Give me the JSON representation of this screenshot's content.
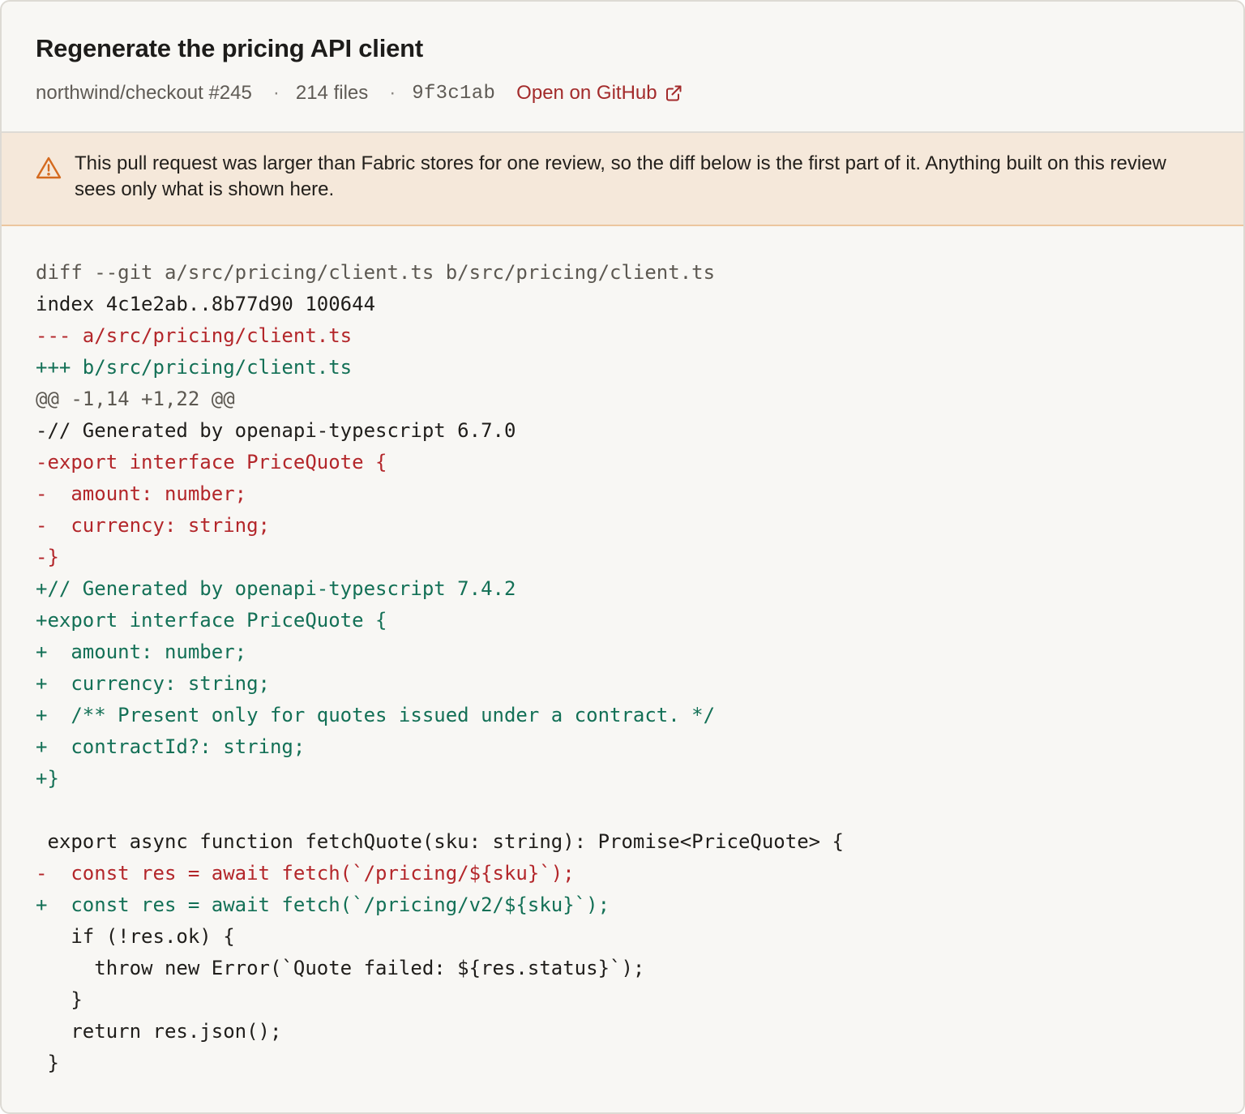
{
  "header": {
    "title": "Regenerate the pricing API client",
    "repo_pr": "northwind/checkout #245",
    "separator": "·",
    "files": "214 files",
    "commit": "9f3c1ab",
    "github_link": "Open on GitHub",
    "github_icon": "external-link-icon"
  },
  "notice": {
    "icon": "warning-triangle-icon",
    "text": "This pull request was larger than Fabric stores for one review, so the diff below is the first part of it. Anything built on this review sees only what is shown here."
  },
  "colors": {
    "deleted": "#b3262a",
    "added": "#137056",
    "link": "#a32b2b",
    "notice_bg": "#f5e8da"
  },
  "diff": {
    "lines": [
      {
        "kind": "meta",
        "text": "diff --git a/src/pricing/client.ts b/src/pricing/client.ts"
      },
      {
        "kind": "ctx",
        "text": "index 4c1e2ab..8b77d90 100644"
      },
      {
        "kind": "del",
        "text": "--- a/src/pricing/client.ts"
      },
      {
        "kind": "add",
        "text": "+++ b/src/pricing/client.ts"
      },
      {
        "kind": "meta",
        "text": "@@ -1,14 +1,22 @@"
      },
      {
        "kind": "ctx",
        "text": "-// Generated by openapi-typescript 6.7.0"
      },
      {
        "kind": "del",
        "text": "-export interface PriceQuote {"
      },
      {
        "kind": "del",
        "text": "-  amount: number;"
      },
      {
        "kind": "del",
        "text": "-  currency: string;"
      },
      {
        "kind": "del",
        "text": "-}"
      },
      {
        "kind": "add",
        "text": "+// Generated by openapi-typescript 7.4.2"
      },
      {
        "kind": "add",
        "text": "+export interface PriceQuote {"
      },
      {
        "kind": "add",
        "text": "+  amount: number;"
      },
      {
        "kind": "add",
        "text": "+  currency: string;"
      },
      {
        "kind": "add",
        "text": "+  /** Present only for quotes issued under a contract. */"
      },
      {
        "kind": "add",
        "text": "+  contractId?: string;"
      },
      {
        "kind": "add",
        "text": "+}"
      },
      {
        "kind": "ctx",
        "text": " "
      },
      {
        "kind": "ctx",
        "text": " export async function fetchQuote(sku: string): Promise<PriceQuote> {"
      },
      {
        "kind": "del",
        "text": "-  const res = await fetch(`/pricing/${sku}`);"
      },
      {
        "kind": "add",
        "text": "+  const res = await fetch(`/pricing/v2/${sku}`);"
      },
      {
        "kind": "ctx",
        "text": "   if (!res.ok) {"
      },
      {
        "kind": "ctx",
        "text": "     throw new Error(`Quote failed: ${res.status}`);"
      },
      {
        "kind": "ctx",
        "text": "   }"
      },
      {
        "kind": "ctx",
        "text": "   return res.json();"
      },
      {
        "kind": "ctx",
        "text": " }"
      }
    ]
  }
}
